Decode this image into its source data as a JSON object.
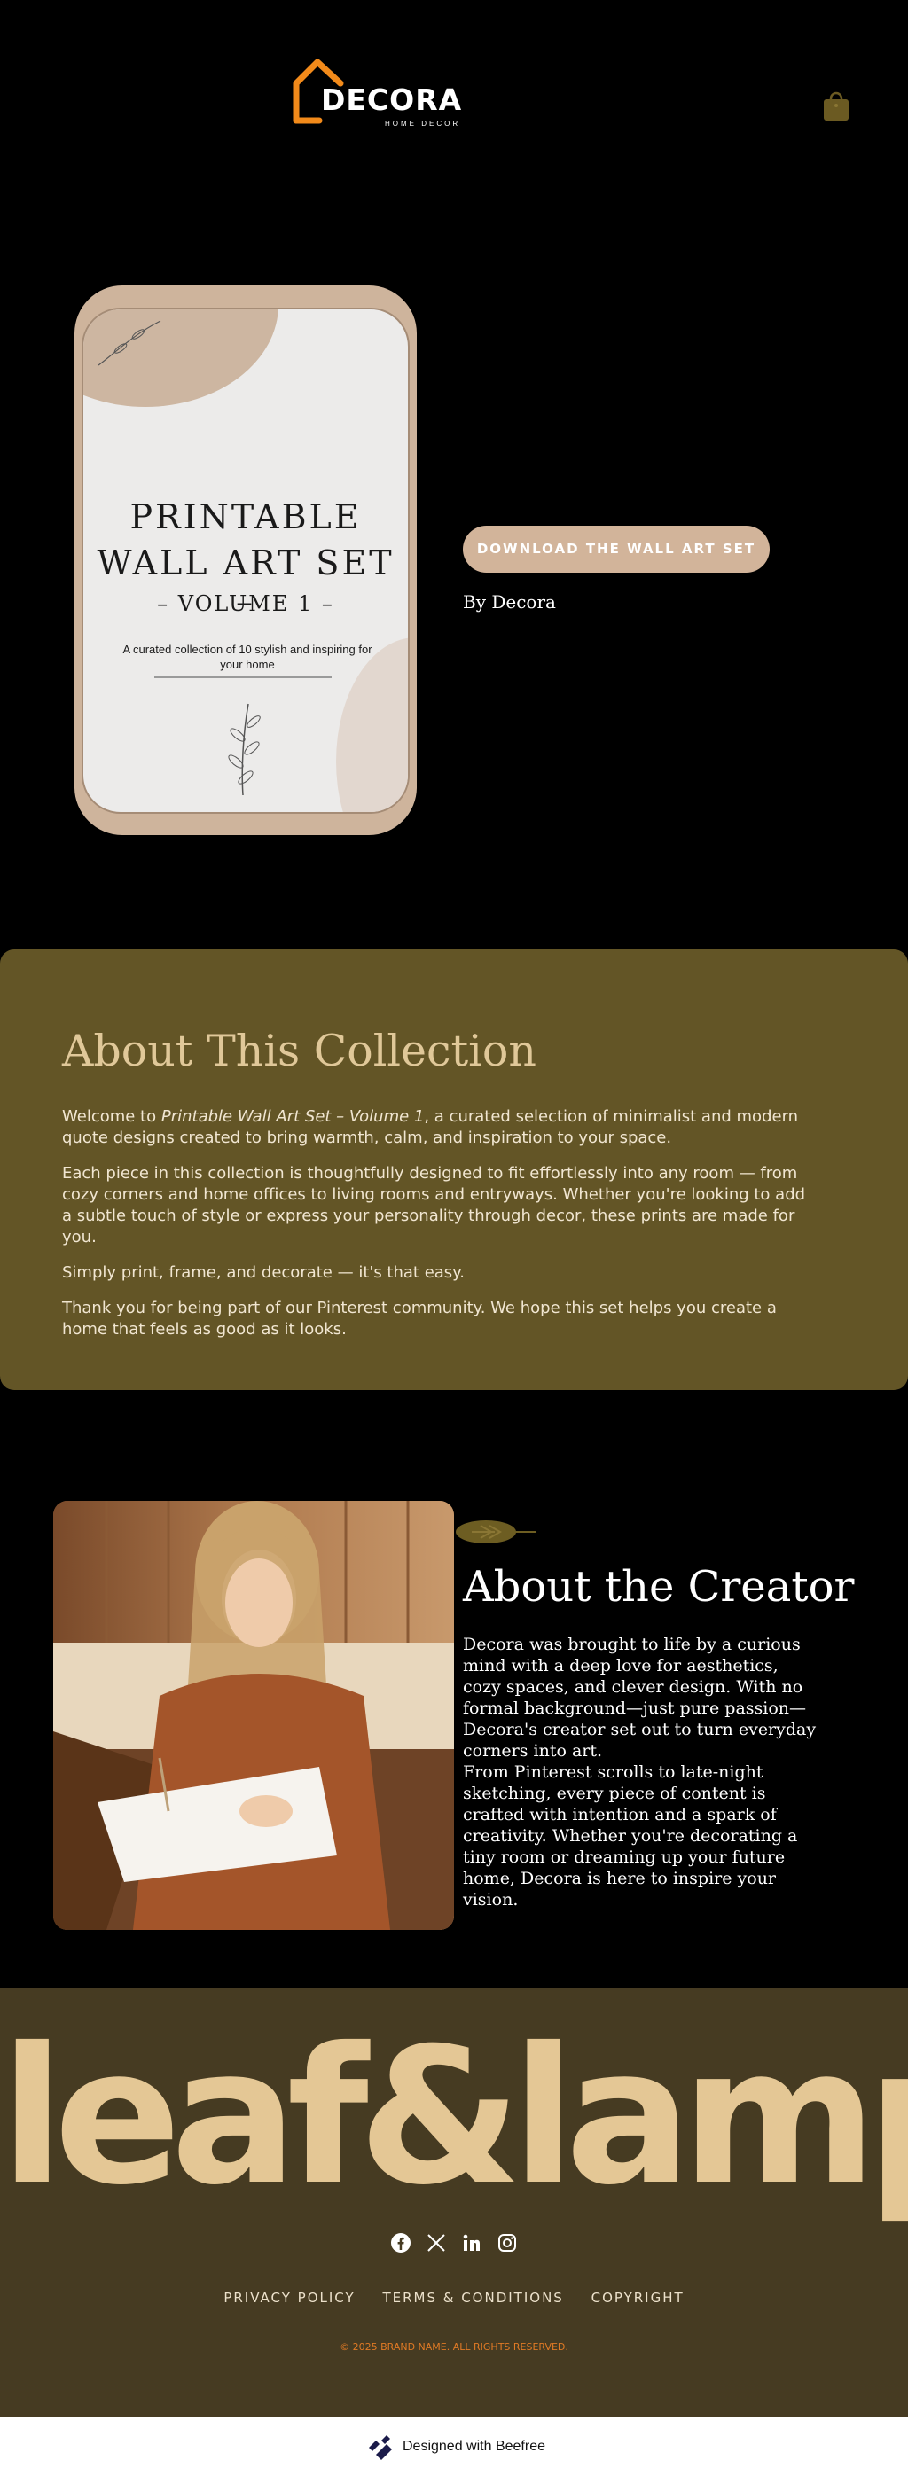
{
  "header": {
    "brand": "DECORA",
    "brand_sub": "HOME DECOR",
    "brand_color": "#f28a1a",
    "cart_icon": "shopping-bag-icon"
  },
  "hero": {
    "poster": {
      "line1": "PRINTABLE",
      "line2": "WALL ART SET –",
      "line3": "– VOLUME 1 –",
      "subtitle": "A curated collection of 10 stylish and inspiring for your home"
    },
    "button_label": "DOWNLOAD THE WALL ART SET",
    "byline": "By Decora",
    "accent": "#d2b49a"
  },
  "about_collection": {
    "title": "About This Collection",
    "p1_before": "Welcome to ",
    "p1_italic": "Printable Wall Art Set – Volume 1",
    "p1_after": ", a curated selection of minimalist and modern quote designs created to bring warmth, calm, and inspiration to your space.",
    "p2": "Each piece in this collection is thoughtfully designed to fit effortlessly into any room — from cozy corners and home offices to living rooms and entryways. Whether you're looking to add a subtle touch of style or express your personality through decor, these prints are made for you.",
    "p3": "Simply print, frame, and decorate — it's that easy.",
    "p4": "Thank you for being part of our Pinterest community. We hope this set helps you create a home that feels as good as it looks.",
    "background": "#635526"
  },
  "about_creator": {
    "title": "About the Creator",
    "p1": "Decora was brought to life by a curious mind with a deep love for aesthetics, cozy spaces, and clever design. With no formal background—just pure passion—Decora's creator set out to turn everyday corners into art.",
    "p2": "From Pinterest scrolls to late-night sketching, every piece of content is crafted with intention and a spark of creativity. Whether you're decorating a tiny room or dreaming up your future home, Decora is here to inspire your vision."
  },
  "footer": {
    "brand": "leaf&lamp",
    "socials": [
      "facebook-icon",
      "x-icon",
      "linkedin-icon",
      "instagram-icon"
    ],
    "links": [
      "PRIVACY POLICY",
      "TERMS & CONDITIONS",
      "COPYRIGHT"
    ],
    "copyright": "© 2025 BRAND NAME. ALL RIGHTS RESERVED.",
    "background": "#463b22"
  },
  "beefree": {
    "label": "Designed with Beefree"
  }
}
